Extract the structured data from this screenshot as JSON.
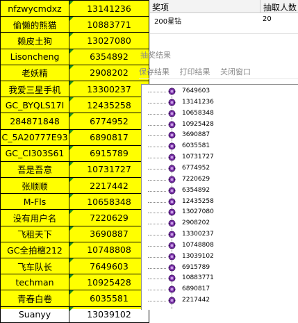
{
  "sheet": {
    "rows": [
      {
        "name": "nfzwycmdxz",
        "value": "13141236"
      },
      {
        "name": "偷懒的熊猫",
        "value": "10883771"
      },
      {
        "name": "赖皮土狗",
        "value": "13027080"
      },
      {
        "name": "Lisoncheng",
        "value": "6354892"
      },
      {
        "name": "老妖精",
        "value": "2908202"
      },
      {
        "name": "我爱三星手机",
        "value": "13300237"
      },
      {
        "name": "GC_BYQLS17I",
        "value": "12435258"
      },
      {
        "name": "284871848",
        "value": "6774952"
      },
      {
        "name": "C_5A20777E93",
        "value": "6890817"
      },
      {
        "name": "GC_CI303S61",
        "value": "6915789"
      },
      {
        "name": "吾是吾意",
        "value": "10731727"
      },
      {
        "name": "张顺顺",
        "value": "2217442"
      },
      {
        "name": "M-Fls",
        "value": "10658348"
      },
      {
        "name": "没有用户名",
        "value": "7220629"
      },
      {
        "name": "飞租天下",
        "value": "3690887"
      },
      {
        "name": "GC全拍檀212",
        "value": "10748808"
      },
      {
        "name": "飞车队长",
        "value": "7649603"
      },
      {
        "name": "techman",
        "value": "10925428"
      },
      {
        "name": "青春白卷",
        "value": "6035581"
      },
      {
        "name": "Suanyy",
        "value": "13039102"
      }
    ]
  },
  "prize_table": {
    "headers": [
      "奖项",
      "抽取人数"
    ],
    "row": {
      "prize": "200星钻",
      "count": "20"
    }
  },
  "dialog": {
    "title": "抽奖结果",
    "menu": [
      "保存结果",
      "打印结果",
      "关闭窗口"
    ],
    "results": [
      "7649603",
      "13141236",
      "10658348",
      "10925428",
      "3690887",
      "6035581",
      "10731727",
      "6774952",
      "7220629",
      "6354892",
      "12435258",
      "13027080",
      "2908202",
      "13300237",
      "10748808",
      "13039102",
      "6915789",
      "10883771",
      "6890817",
      "2217442"
    ]
  }
}
